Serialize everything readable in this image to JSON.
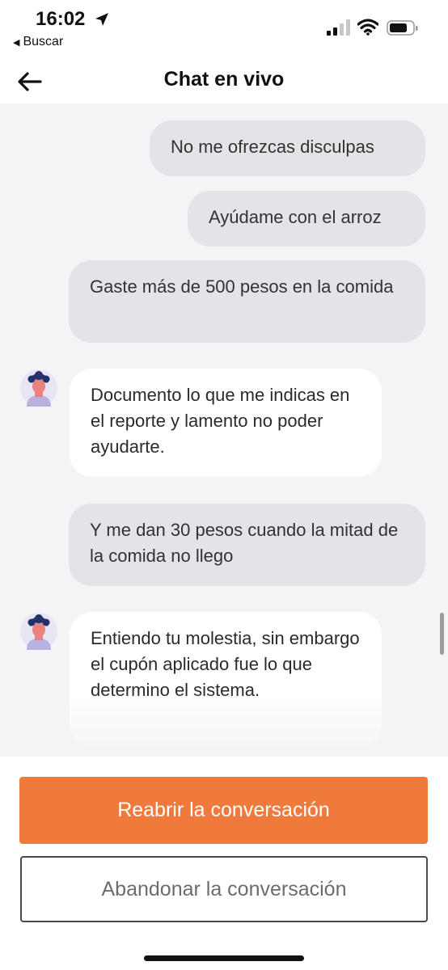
{
  "status_bar": {
    "time": "16:02",
    "back_app_label": "Buscar",
    "icons": [
      "location-arrow-icon",
      "signal-icon",
      "wifi-icon",
      "battery-icon"
    ]
  },
  "nav": {
    "title": "Chat en vivo",
    "back_icon": "arrow-left-icon"
  },
  "messages": [
    {
      "sender": "user",
      "text": "No me ofrezcas disculpas"
    },
    {
      "sender": "user",
      "text": "Ayúdame con el arroz"
    },
    {
      "sender": "user",
      "text": "Gaste más de 500 pesos en la comida"
    },
    {
      "sender": "agent",
      "text": "Documento lo que me indicas en el reporte y lamento no poder ayudarte."
    },
    {
      "sender": "user",
      "text": "Y me dan 30 pesos cuando la mitad de la comida no llego"
    },
    {
      "sender": "agent",
      "text": "Entiendo tu molestia, sin embargo el cupón aplicado fue lo que determino el sistema."
    }
  ],
  "actions": {
    "reopen_label": "Reabrir la conversación",
    "abandon_label": "Abandonar la conversación"
  },
  "colors": {
    "accent": "#ef7a3b",
    "user_bubble": "#e3e3e8",
    "agent_bubble": "#ffffff",
    "chat_background": "#f4f4f6"
  }
}
